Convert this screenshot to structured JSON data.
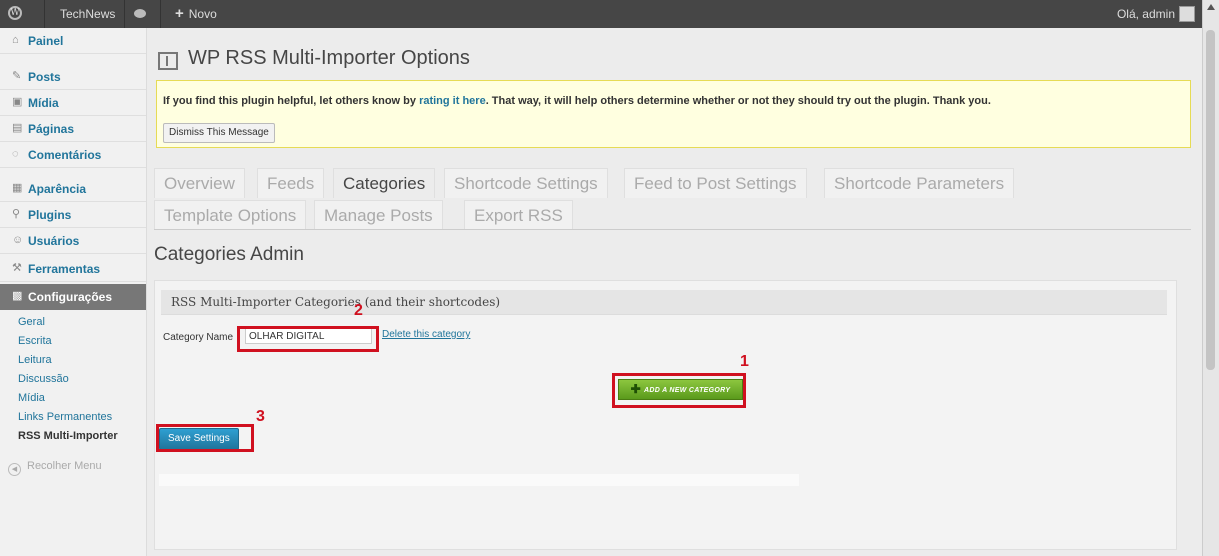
{
  "adminbar": {
    "site_name": "TechNews",
    "new_label": "Novo",
    "howdy": "Olá, admin"
  },
  "sidebar": {
    "items": [
      {
        "label": "Painel",
        "icon": "home-icon"
      },
      {
        "label": "Posts",
        "icon": "pin-icon"
      },
      {
        "label": "Mídia",
        "icon": "media-icon"
      },
      {
        "label": "Páginas",
        "icon": "pages-icon"
      },
      {
        "label": "Comentários",
        "icon": "comments-icon"
      },
      {
        "label": "Aparência",
        "icon": "appearance-icon"
      },
      {
        "label": "Plugins",
        "icon": "plugins-icon"
      },
      {
        "label": "Usuários",
        "icon": "users-icon"
      },
      {
        "label": "Ferramentas",
        "icon": "tools-icon"
      },
      {
        "label": "Configurações",
        "icon": "settings-icon"
      }
    ],
    "submenu": [
      "Geral",
      "Escrita",
      "Leitura",
      "Discussão",
      "Mídia",
      "Links Permanentes",
      "RSS Multi-Importer"
    ],
    "collapse_label": "Recolher Menu"
  },
  "page": {
    "title": "WP RSS Multi-Importer Options"
  },
  "notice": {
    "text_before": "If you find this plugin helpful, let others know by ",
    "link_text": "rating it here",
    "text_after": ". That way, it will help others determine whether or not they should try out the plugin. Thank you.",
    "dismiss_label": "Dismiss This Message"
  },
  "tabs": [
    "Overview",
    "Feeds",
    "Categories",
    "Shortcode Settings",
    "Feed to Post Settings",
    "Shortcode Parameters",
    "Template Options",
    "Manage Posts",
    "Export RSS"
  ],
  "active_tab": "Categories",
  "section": {
    "title": "Categories Admin",
    "box_title": "RSS Multi-Importer Categories (and their shortcodes)",
    "category_label": "Category Name",
    "category_value": "OLHAR DIGITAL",
    "delete_link": "Delete this category",
    "add_button": "ADD A NEW CATEGORY",
    "save_button": "Save Settings"
  },
  "annotations": [
    "1",
    "2",
    "3"
  ],
  "colors": {
    "annotation": "#d0101f",
    "link": "#21759b",
    "add_button": "#6aaa2a",
    "save_button": "#21759b"
  }
}
